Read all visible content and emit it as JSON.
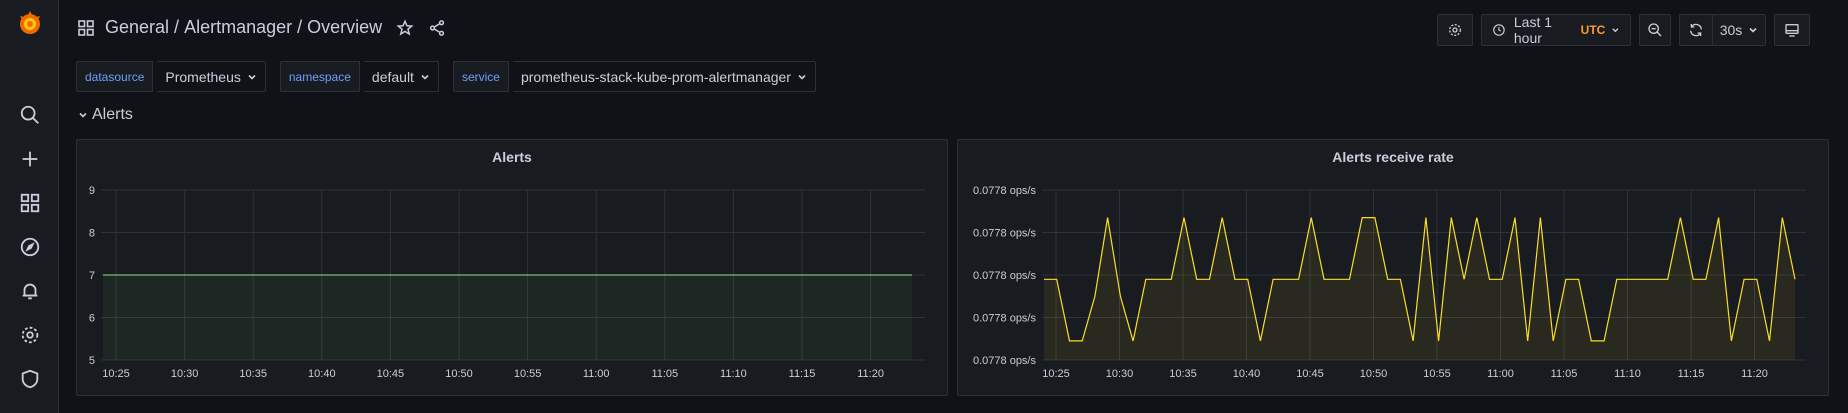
{
  "breadcrumb": {
    "folder": "General",
    "separator": " / ",
    "dashboard": "Alertmanager / Overview"
  },
  "toolbar": {
    "time_range": "Last 1 hour",
    "timezone": "UTC",
    "refresh": "30s"
  },
  "variables": [
    {
      "label": "datasource",
      "value": "Prometheus"
    },
    {
      "label": "namespace",
      "value": "default"
    },
    {
      "label": "service",
      "value": "prometheus-stack-kube-prom-alertmanager"
    }
  ],
  "row": {
    "title": "Alerts"
  },
  "colors": {
    "accent": "#6e9fff",
    "series_green": "#73bf69",
    "series_yellow": "#fade2a",
    "utc": "#ff9830"
  },
  "panels": [
    {
      "title": "Alerts"
    },
    {
      "title": "Alerts receive rate"
    }
  ],
  "chart_data": [
    {
      "type": "area",
      "title": "Alerts",
      "categories": [
        "10:25",
        "10:30",
        "10:35",
        "10:40",
        "10:45",
        "10:50",
        "10:55",
        "11:00",
        "11:05",
        "11:10",
        "11:15",
        "11:20"
      ],
      "y_ticks": [
        "9",
        "8",
        "7",
        "6",
        "5"
      ],
      "ylim": [
        5,
        9
      ],
      "series": [
        {
          "values": [
            7,
            7,
            7,
            7,
            7,
            7,
            7,
            7,
            7,
            7,
            7,
            7
          ]
        }
      ],
      "grid": true
    },
    {
      "type": "line",
      "title": "Alerts receive rate",
      "categories": [
        "10:25",
        "10:30",
        "10:35",
        "10:40",
        "10:45",
        "10:50",
        "10:55",
        "11:00",
        "11:05",
        "11:10",
        "11:15",
        "11:20"
      ],
      "y_ticks": [
        "0.0778 ops/s",
        "0.0778 ops/s",
        "0.0778 ops/s",
        "0.0778 ops/s",
        "0.0778 ops/s"
      ],
      "ylim": [
        0,
        4
      ],
      "series": [
        {
          "values": [
            1.9,
            1.9,
            0.45,
            0.45,
            1.5,
            3.35,
            1.5,
            0.45,
            1.9,
            1.9,
            1.9,
            3.35,
            1.9,
            1.9,
            3.35,
            1.9,
            1.9,
            0.45,
            1.9,
            1.9,
            1.9,
            3.35,
            1.9,
            1.9,
            1.9,
            3.35,
            3.35,
            1.9,
            1.9,
            0.45,
            3.35,
            0.45,
            3.35,
            1.9,
            3.35,
            1.9,
            1.9,
            3.35,
            0.45,
            3.35,
            0.45,
            1.9,
            1.9,
            0.45,
            0.45,
            1.9,
            1.9,
            1.9,
            1.9,
            1.9,
            3.35,
            1.9,
            1.9,
            3.35,
            0.45,
            1.9,
            1.9,
            0.45,
            3.35,
            1.9
          ]
        }
      ],
      "grid": true
    }
  ]
}
